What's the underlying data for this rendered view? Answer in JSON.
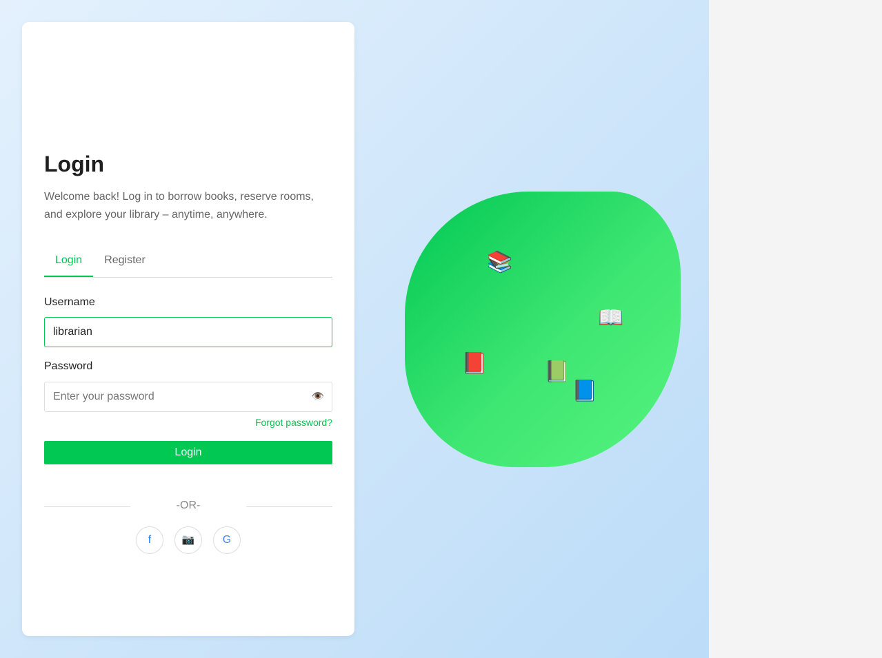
{
  "login": {
    "title": "Login",
    "subtitle": "Welcome back! Log in to borrow books, reserve rooms, and explore your library – anytime, anywhere.",
    "tabs": [
      {
        "label": "Login",
        "active": true
      },
      {
        "label": "Register",
        "active": false
      }
    ],
    "username": {
      "label": "Username",
      "value": "librarian"
    },
    "password": {
      "label": "Password",
      "placeholder": "Enter your password",
      "toggle_icon": "eye-icon",
      "toggle_glyph": "👁️"
    },
    "forgot_label": "Forgot password?",
    "submit_label": "Login",
    "divider_text": "-OR-",
    "social": [
      {
        "name": "facebook",
        "glyph": "f"
      },
      {
        "name": "instagram",
        "glyph": "📷"
      },
      {
        "name": "google",
        "glyph": "G"
      }
    ]
  },
  "illustration": {
    "icons": [
      {
        "name": "books-stack-icon",
        "glyph": "📚"
      },
      {
        "name": "open-book-icon",
        "glyph": "📖"
      },
      {
        "name": "red-book-icon",
        "glyph": "📕"
      },
      {
        "name": "green-book-icon",
        "glyph": "📗"
      },
      {
        "name": "blue-book-icon",
        "glyph": "📘"
      }
    ]
  },
  "colors": {
    "accent": "#00c853",
    "blob_start": "#00c853",
    "blob_end": "#55f47e",
    "background": "#cfe6fa"
  }
}
